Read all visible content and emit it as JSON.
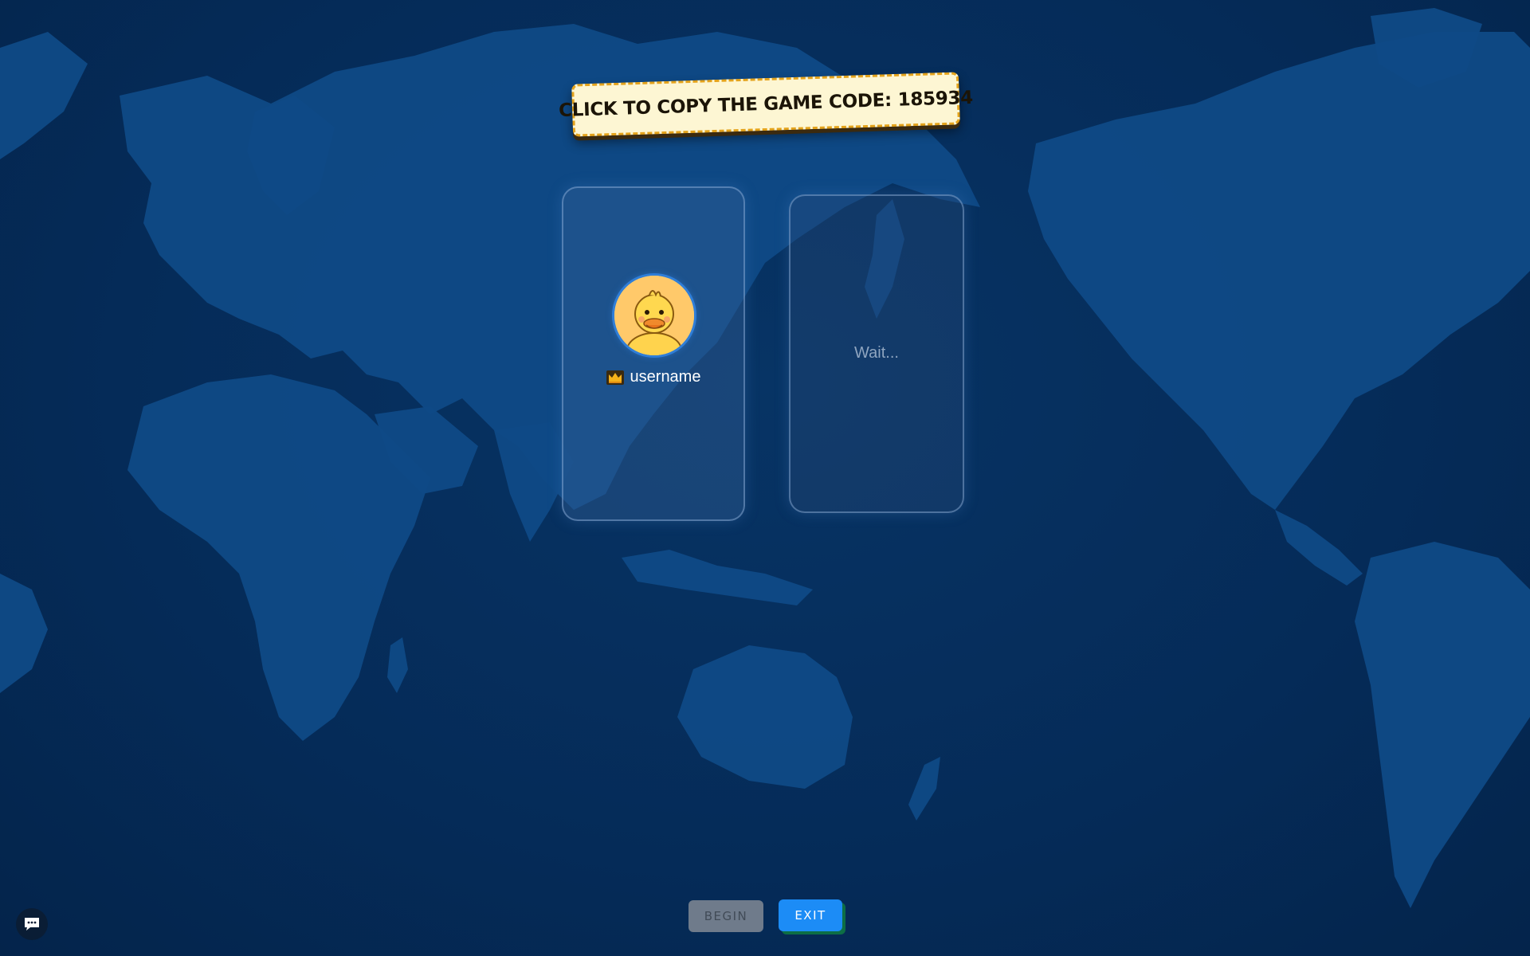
{
  "banner": {
    "label": "CLICK TO COPY THE GAME CODE: 185934"
  },
  "players": [
    {
      "name": "username",
      "is_host": true,
      "avatar": "duck-avatar"
    }
  ],
  "waiting_slot": {
    "label": "Wait..."
  },
  "buttons": {
    "begin": "BEGIN",
    "exit": "EXIT"
  },
  "icons": {
    "host": "crown-icon",
    "chat": "chat-bubble-icon"
  },
  "colors": {
    "background": "#052b58",
    "land": "#0f4a86",
    "banner_bg": "#fdf6d3",
    "banner_border": "#e4a31c",
    "exit_button": "#1c8cf6",
    "begin_button_disabled": "#6f7b8b"
  }
}
